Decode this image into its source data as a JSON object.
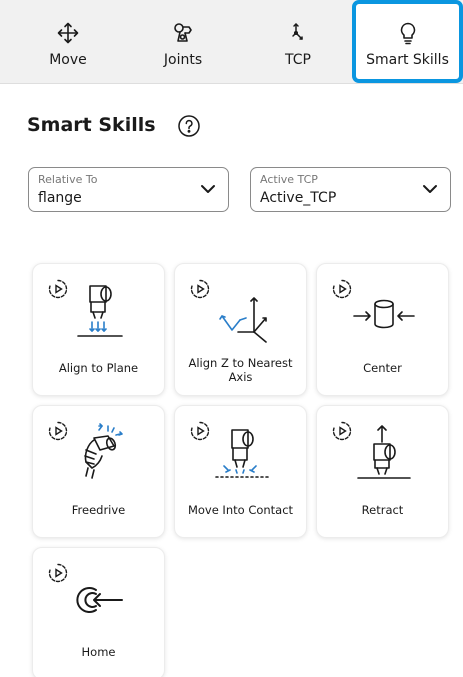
{
  "tabs": [
    {
      "label": "Move",
      "icon": "move-arrows-icon"
    },
    {
      "label": "Joints",
      "icon": "joint-icon"
    },
    {
      "label": "TCP",
      "icon": "tcp-axes-icon"
    },
    {
      "label": "Smart Skills",
      "icon": "lightbulb-icon",
      "active": true
    }
  ],
  "header": {
    "title": "Smart Skills",
    "help_icon": "help-circle-icon"
  },
  "relative_to": {
    "label": "Relative To",
    "value": "flange"
  },
  "active_tcp": {
    "label": "Active TCP",
    "value": "Active_TCP"
  },
  "skills": [
    {
      "label": "Align to Plane",
      "icon": "align-to-plane-icon"
    },
    {
      "label": "Align Z to Nearest Axis",
      "icon": "align-z-axis-icon"
    },
    {
      "label": "Center",
      "icon": "center-icon"
    },
    {
      "label": "Freedrive",
      "icon": "freedrive-icon"
    },
    {
      "label": "Move Into Contact",
      "icon": "move-into-contact-icon"
    },
    {
      "label": "Retract",
      "icon": "retract-icon"
    },
    {
      "label": "Home",
      "icon": "home-icon"
    }
  ],
  "colors": {
    "accent": "#0a96e0",
    "text": "#1a1a1a",
    "tab_bg": "#f1f1f1"
  }
}
